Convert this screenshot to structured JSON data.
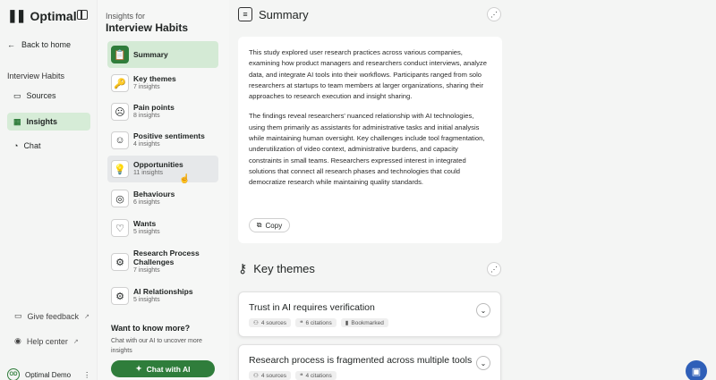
{
  "brand": {
    "mark": "❚❚",
    "name": "Optimal"
  },
  "nav": {
    "back": "Back to home",
    "section": "Interview Habits",
    "items": [
      {
        "label": "Sources",
        "icon": "video-icon"
      },
      {
        "label": "Insights",
        "icon": "insights-icon"
      },
      {
        "label": "Chat",
        "icon": "chat-icon"
      }
    ],
    "feedback": "Give feedback",
    "help": "Help center",
    "user": {
      "initials": "OD",
      "name": "Optimal Demo",
      "menu": "⋮"
    }
  },
  "insights": {
    "kicker": "Insights for",
    "title": "Interview Habits",
    "items": [
      {
        "name": "Summary",
        "sub": "",
        "icon": "📋"
      },
      {
        "name": "Key themes",
        "sub": "7 insights",
        "icon": "🔑"
      },
      {
        "name": "Pain points",
        "sub": "8 insights",
        "icon": "☹"
      },
      {
        "name": "Positive sentiments",
        "sub": "4 insights",
        "icon": "☺"
      },
      {
        "name": "Opportunities",
        "sub": "11 insights",
        "icon": "💡"
      },
      {
        "name": "Behaviours",
        "sub": "6 insights",
        "icon": "◎"
      },
      {
        "name": "Wants",
        "sub": "5 insights",
        "icon": "♡"
      },
      {
        "name": "Research Process Challenges",
        "sub": "7 insights",
        "icon": "⚙"
      },
      {
        "name": "AI Relationships",
        "sub": "5 insights",
        "icon": "⚙"
      }
    ],
    "want_title": "Want to know more?",
    "want_sub": "Chat with our AI to uncover more insights",
    "chat_button": "Chat with AI"
  },
  "main": {
    "summary_title": "Summary",
    "summary_p1": "This study explored user research practices across various companies, examining how product managers and researchers conduct interviews, analyze data, and integrate AI tools into their workflows. Participants ranged from solo researchers at startups to team members at larger organizations, sharing their approaches to research execution and insight sharing.",
    "summary_p2": "The findings reveal researchers' nuanced relationship with AI technologies, using them primarily as assistants for administrative tasks and initial analysis while maintaining human oversight. Key challenges include tool fragmentation, underutilization of video context, administrative burdens, and capacity constraints in small teams. Researchers expressed interest in integrated solutions that connect all research phases and technologies that could democratize research while maintaining quality standards.",
    "copy": "Copy",
    "themes_title": "Key themes",
    "themes": [
      {
        "title": "Trust in AI requires verification",
        "sources": "4 sources",
        "citations": "6 citations",
        "extra": "Bookmarked"
      },
      {
        "title": "Research process is fragmented across multiple tools",
        "sources": "4 sources",
        "citations": "4 citations",
        "extra": ""
      }
    ]
  }
}
